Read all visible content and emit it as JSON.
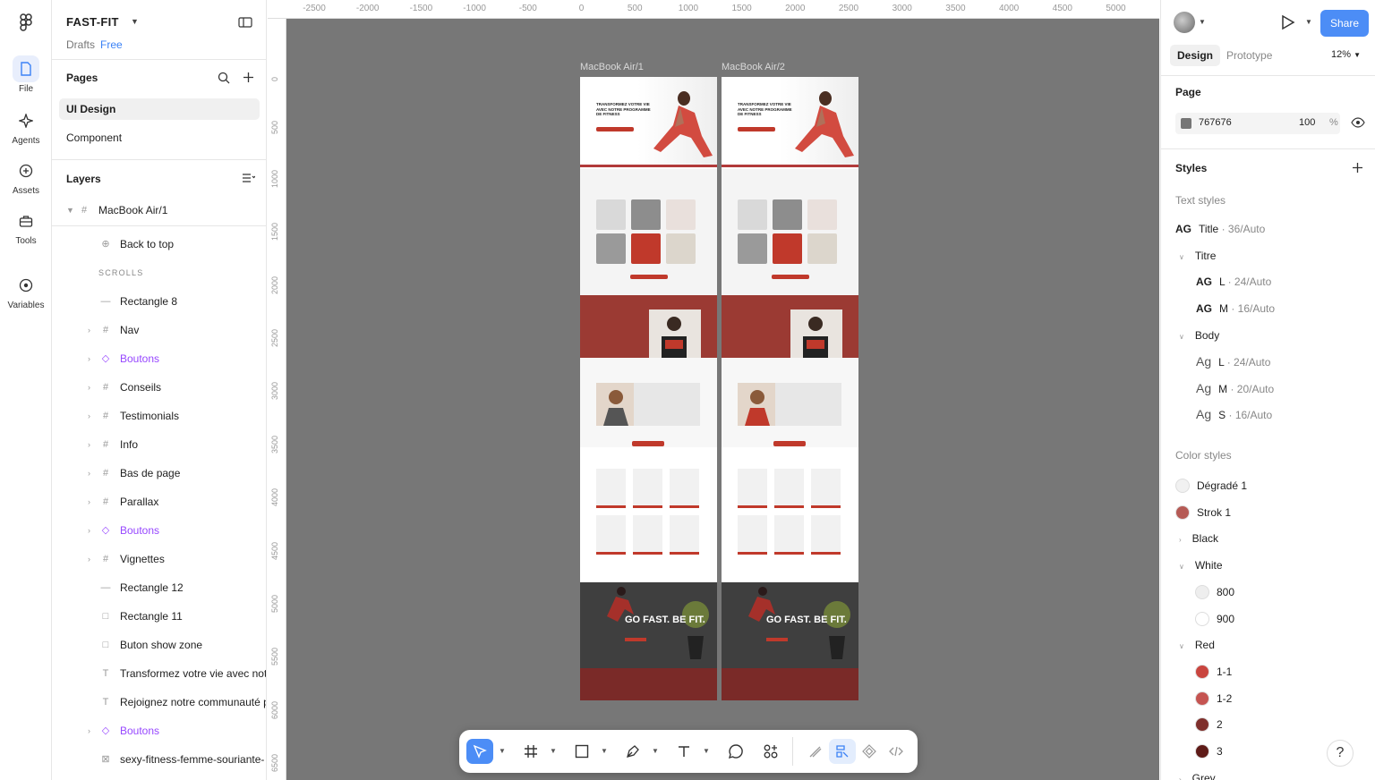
{
  "project": {
    "name": "FAST-FIT",
    "location": "Drafts",
    "plan": "Free"
  },
  "rail": [
    {
      "label": "File",
      "icon": "file-icon"
    },
    {
      "label": "Agents",
      "icon": "agents-icon"
    },
    {
      "label": "Assets",
      "icon": "assets-icon"
    },
    {
      "label": "Tools",
      "icon": "tools-icon"
    },
    {
      "label": "Variables",
      "icon": "variables-icon"
    }
  ],
  "pages": {
    "title": "Pages",
    "items": [
      "UI Design",
      "Component"
    ]
  },
  "layers": {
    "title": "Layers",
    "root": "MacBook Air/1",
    "items": [
      {
        "name": "Back to top",
        "kind": "instance"
      },
      {
        "name": "SCROLLS",
        "kind": "section"
      },
      {
        "name": "Rectangle 8",
        "kind": "line"
      },
      {
        "name": "Nav",
        "kind": "frame"
      },
      {
        "name": "Boutons",
        "kind": "component"
      },
      {
        "name": "Conseils",
        "kind": "frame"
      },
      {
        "name": "Testimonials",
        "kind": "frame"
      },
      {
        "name": "Info",
        "kind": "frame"
      },
      {
        "name": "Bas de page",
        "kind": "frame"
      },
      {
        "name": "Parallax",
        "kind": "frame"
      },
      {
        "name": "Boutons",
        "kind": "component"
      },
      {
        "name": "Vignettes",
        "kind": "frame"
      },
      {
        "name": "Rectangle 12",
        "kind": "line"
      },
      {
        "name": "Rectangle 11",
        "kind": "rect"
      },
      {
        "name": "Buton show zone",
        "kind": "rect"
      },
      {
        "name": "Transformez votre vie avec notr",
        "kind": "text"
      },
      {
        "name": "Rejoignez notre communauté pa",
        "kind": "text"
      },
      {
        "name": "Boutons",
        "kind": "component"
      },
      {
        "name": "sexy-fitness-femme-souriante-",
        "kind": "image"
      }
    ]
  },
  "canvas": {
    "background": "#767676",
    "ruler_x": [
      "-2500",
      "-2000",
      "-1500",
      "-1000",
      "-500",
      "0",
      "500",
      "1000",
      "1500",
      "2000",
      "2500",
      "3000",
      "3500",
      "4000",
      "4500",
      "5000"
    ],
    "ruler_y": [
      "0",
      "500",
      "1000",
      "1500",
      "2000",
      "2500",
      "3000",
      "3500",
      "4000",
      "4500",
      "5000",
      "5500",
      "6000",
      "6500"
    ],
    "frames": [
      {
        "label": "MacBook Air/1",
        "hero": "TRANSFORMEZ VOTRE VIE AVEC NOTRE PROGRAMME DE FITNESS",
        "tagline": "GO FAST. BE FIT."
      },
      {
        "label": "MacBook Air/2",
        "hero": "TRANSFORMEZ VOTRE VIE AVEC NOTRE PROGRAMME DE FITNESS",
        "tagline": "GO FAST. BE FIT."
      }
    ]
  },
  "toolbar": [
    "move-tool",
    "frame-tool",
    "shape-tool",
    "pen-tool",
    "text-tool",
    "comment-tool",
    "actions-tool",
    "draw-mode",
    "design-mode",
    "dev-mode",
    "code-mode"
  ],
  "right": {
    "share": "Share",
    "tabs": [
      "Design",
      "Prototype"
    ],
    "zoom": "12%",
    "page": {
      "title": "Page",
      "color": "767676",
      "opacity": "100",
      "unit": "%"
    },
    "styles_title": "Styles",
    "text_styles_label": "Text styles",
    "text_styles": {
      "title": {
        "sample": "AG",
        "name": "Title",
        "meta": "· 36/Auto"
      },
      "titre_group": "Titre",
      "titre": [
        {
          "sample": "AG",
          "name": "L",
          "meta": "· 24/Auto"
        },
        {
          "sample": "AG",
          "name": "M",
          "meta": "· 16/Auto"
        }
      ],
      "body_group": "Body",
      "body": [
        {
          "sample": "Ag",
          "name": "L",
          "meta": "· 24/Auto"
        },
        {
          "sample": "Ag",
          "name": "M",
          "meta": "· 20/Auto"
        },
        {
          "sample": "Ag",
          "name": "S",
          "meta": "· 16/Auto"
        }
      ]
    },
    "color_styles_label": "Color styles",
    "colors": [
      {
        "name": "Dégradé 1",
        "hex": "#f1f1f1"
      },
      {
        "name": "Strok 1",
        "hex": "#b55a55"
      },
      {
        "name": "Black",
        "group": true
      },
      {
        "name": "White",
        "group": true,
        "open": true
      },
      {
        "name": "800",
        "hex": "#eeeeee",
        "indent": true
      },
      {
        "name": "900",
        "hex": "#ffffff",
        "indent": true
      },
      {
        "name": "Red",
        "group": true,
        "open": true
      },
      {
        "name": "1-1",
        "hex": "#c9453f",
        "indent": true
      },
      {
        "name": "1-2",
        "hex": "#c55451",
        "indent": true
      },
      {
        "name": "2",
        "hex": "#7f302c",
        "indent": true
      },
      {
        "name": "3",
        "hex": "#5e1b18",
        "indent": true
      },
      {
        "name": "Grey",
        "group": true
      }
    ]
  },
  "help": "?"
}
